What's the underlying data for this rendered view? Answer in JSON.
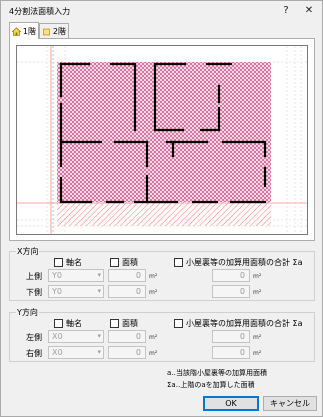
{
  "window": {
    "title": "4分割法面積入力",
    "help": "?",
    "close": "✕"
  },
  "tabs": [
    {
      "label": "1階",
      "icon": "house-icon",
      "active": true
    },
    {
      "label": "2階",
      "icon": "square-icon",
      "active": false
    }
  ],
  "x_direction": {
    "title": "X方向",
    "axis_label": "軸名",
    "area_label": "面積",
    "loft_label": "小屋裏等の加算用面積の合計 Σa",
    "rows": [
      {
        "label": "上側",
        "axis": "Y0",
        "area": "0",
        "loft": "0",
        "unit": "m²"
      },
      {
        "label": "下側",
        "axis": "Y0",
        "area": "0",
        "loft": "0",
        "unit": "m²"
      }
    ]
  },
  "y_direction": {
    "title": "Y方向",
    "axis_label": "軸名",
    "area_label": "面積",
    "loft_label": "小屋裏等の加算用面積の合計 Σa",
    "rows": [
      {
        "label": "左側",
        "axis": "X0",
        "area": "0",
        "loft": "0",
        "unit": "m²"
      },
      {
        "label": "右側",
        "axis": "X0",
        "area": "0",
        "loft": "0",
        "unit": "m²"
      }
    ]
  },
  "notes": [
    "a‥当該階小屋裏等の加算用面積",
    "Σa‥上階のaを加算した面積"
  ],
  "buttons": {
    "ok": "OK",
    "cancel": "キャンセル"
  },
  "colors": {
    "hatch": "#c2185b",
    "wall": "#000000",
    "grid": "#bdbdbd",
    "axis": "#ff6a6a"
  }
}
